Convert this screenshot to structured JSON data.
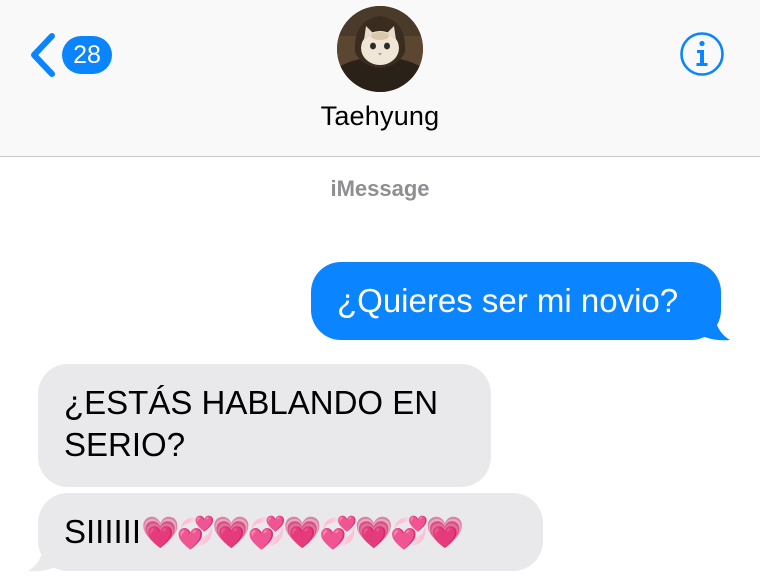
{
  "header": {
    "back_count": "28",
    "contact_name": "Taehyung",
    "icons": {
      "back": "chevron-left-icon",
      "info": "info-icon"
    },
    "accent_color": "#0a84ff"
  },
  "conversation": {
    "service_label": "iMessage",
    "messages": [
      {
        "direction": "outgoing",
        "text": "¿Quieres ser mi novio?",
        "color": "#0a84ff"
      },
      {
        "direction": "incoming",
        "text": "¿ESTÁS HABLANDO EN SERIO?",
        "color": "#e9e9eb"
      },
      {
        "direction": "incoming",
        "text": "SIIIIII",
        "emoji": "💗💞💗💞💗💞💗💞💗",
        "color": "#e9e9eb"
      }
    ]
  }
}
